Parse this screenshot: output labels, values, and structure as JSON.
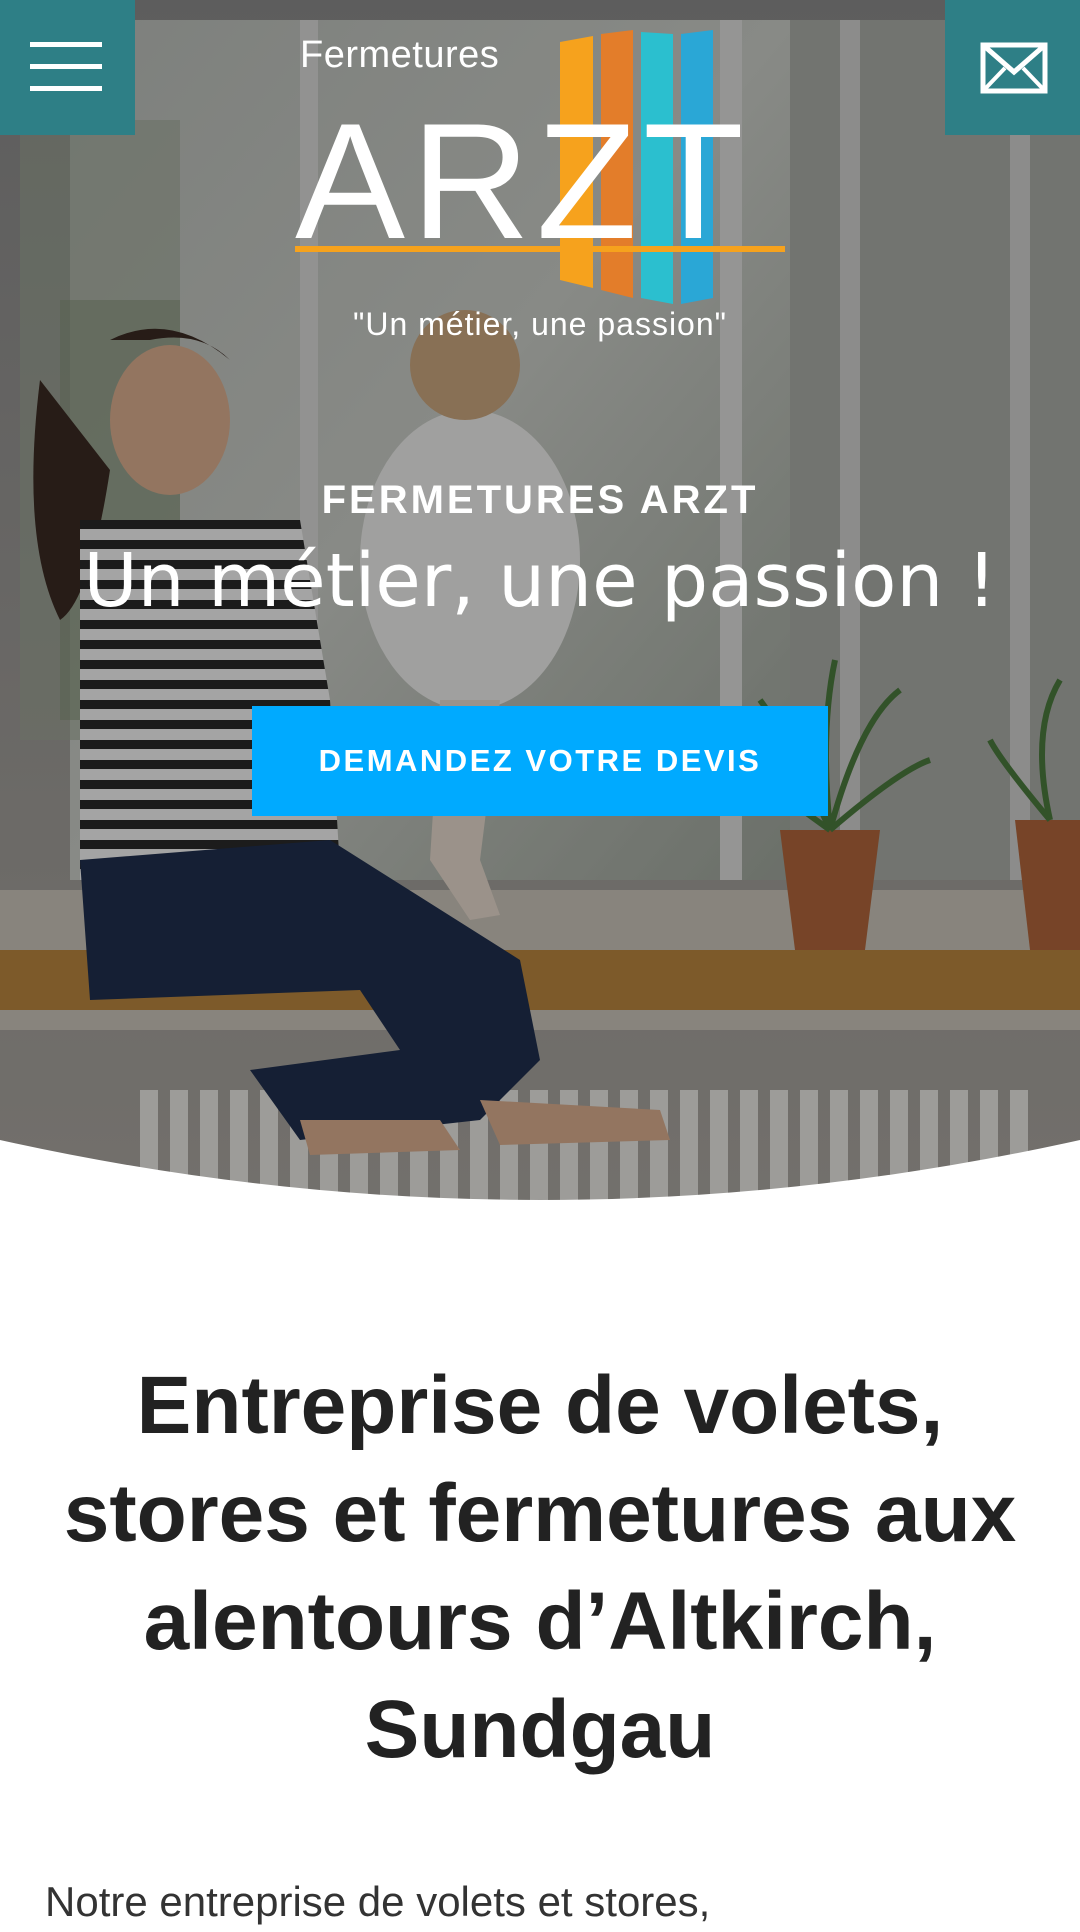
{
  "header": {
    "menu_icon": "hamburger-menu-icon",
    "contact_icon": "envelope-icon",
    "accent_color": "#2e7f86"
  },
  "logo": {
    "top_text": "Fermetures",
    "main_text": "ARZT",
    "slogan": "\"Un métier, une passion\"",
    "colors": [
      "#f6a21d",
      "#2aa7d6",
      "#e37d2a",
      "#2bbfcf"
    ]
  },
  "hero": {
    "kicker": "FERMETURES ARZT",
    "tagline": "Un métier, une passion !",
    "cta_label": "DEMANDEZ VOTRE DEVIS",
    "cta_color": "#00aaff"
  },
  "main": {
    "heading": "Entreprise de volets, stores et fermetures aux alentours d’Altkirch, Sundgau",
    "intro": "Notre entreprise de volets et stores,"
  }
}
